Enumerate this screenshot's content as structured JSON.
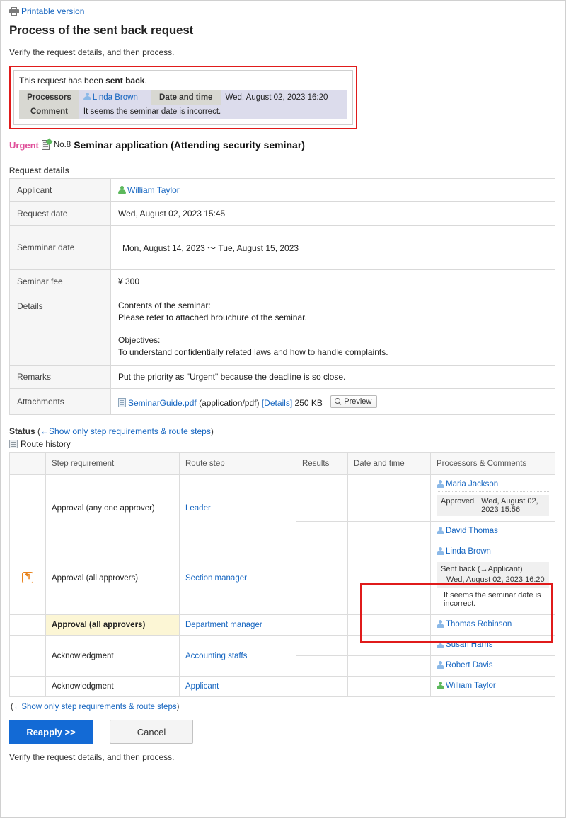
{
  "top": {
    "printable_version": "Printable version",
    "printer_icon": "printer-icon"
  },
  "page_title": "Process of the sent back request",
  "lead_text": "Verify the request details, and then process.",
  "alert": {
    "message_prefix": "This request has been ",
    "message_bold": "sent back",
    "message_suffix": ".",
    "processors_label": "Processors",
    "processor_name": "Linda Brown",
    "datetime_label": "Date and time",
    "datetime_value": "Wed, August 02, 2023 16:20",
    "comment_label": "Comment",
    "comment_value": "It seems the seminar date is incorrect."
  },
  "request_header": {
    "priority": "Urgent",
    "number": "No.8",
    "title": "Seminar application (Attending security seminar)"
  },
  "request_details": {
    "section_label": "Request details",
    "rows": [
      {
        "key": "Applicant",
        "value": "William Taylor",
        "type": "person-green"
      },
      {
        "key": "Request date",
        "value": "Wed, August 02, 2023 15:45",
        "type": "text"
      },
      {
        "key": "Semminar date",
        "value": "Mon, August 14, 2023 〜 Tue, August 15, 2023",
        "type": "indent"
      },
      {
        "key": "Seminar fee",
        "value": "¥ 300",
        "type": "text"
      },
      {
        "key": "Details",
        "value": "",
        "type": "details"
      },
      {
        "key": "Remarks",
        "value": "Put the priority as \"Urgent\" because the deadline is so close.",
        "type": "text"
      },
      {
        "key": "Attachments",
        "value": "",
        "type": "attachment"
      }
    ],
    "details_lines": [
      "Contents of the seminar:",
      "Please refer to attached brouchure of the seminar.",
      "",
      "Objectives:",
      "To understand confidentially related laws and how to handle complaints."
    ],
    "attachment": {
      "filename": "SeminarGuide.pdf",
      "mime": "(application/pdf)",
      "details_link": "[Details]",
      "size": "250 KB",
      "preview_button": "Preview"
    }
  },
  "status": {
    "label": "Status",
    "toggle_link": "(←Show only step requirements & route steps)",
    "toggle_link_text": "←Show only step requirements & route steps",
    "route_history_label": "Route history",
    "toggle_link_bottom_text": "←Show only step requirements & route steps",
    "columns": [
      "",
      "Step requirement",
      "Route step",
      "Results",
      "Date and time",
      "Processors & Comments"
    ],
    "rows": [
      {
        "icon": "",
        "step_requirement": "Approval (any one approver)",
        "route_step": "Leader",
        "results": "",
        "datetime": "",
        "current": false,
        "highlight": false,
        "processors": [
          {
            "name": "Maria Jackson",
            "result_label": "Approved",
            "result_datetime": "Wed, August 02, 2023 15:56",
            "comment": ""
          },
          {
            "name": "David Thomas",
            "result_label": "",
            "result_datetime": "",
            "comment": ""
          }
        ]
      },
      {
        "icon": "sent-back-icon",
        "step_requirement": "Approval (all approvers)",
        "route_step": "Section manager",
        "results": "",
        "datetime": "",
        "current": false,
        "highlight": true,
        "processors": [
          {
            "name": "Linda Brown",
            "result_label": "Sent back (→Applicant)",
            "result_datetime": "Wed, August 02, 2023 16:20",
            "comment": "It seems the seminar date is incorrect."
          }
        ]
      },
      {
        "icon": "",
        "step_requirement": "Approval (all approvers)",
        "route_step": "Department manager",
        "results": "",
        "datetime": "",
        "current": true,
        "highlight": false,
        "processors": [
          {
            "name": "Thomas Robinson",
            "result_label": "",
            "result_datetime": "",
            "comment": ""
          }
        ]
      },
      {
        "icon": "",
        "step_requirement": "Acknowledgment",
        "route_step": "Accounting staffs",
        "results": "",
        "datetime": "",
        "current": false,
        "highlight": false,
        "processors": [
          {
            "name": "Susan Harris",
            "result_label": "",
            "result_datetime": "",
            "comment": ""
          },
          {
            "name": "Robert Davis",
            "result_label": "",
            "result_datetime": "",
            "comment": ""
          }
        ]
      },
      {
        "icon": "",
        "step_requirement": "Acknowledgment",
        "route_step": "Applicant",
        "results": "",
        "datetime": "",
        "current": false,
        "highlight": false,
        "processors": [
          {
            "name": "William Taylor",
            "result_label": "",
            "result_datetime": "",
            "comment": "",
            "green": true
          }
        ]
      }
    ]
  },
  "footer": {
    "reapply_button": "Reapply >>",
    "cancel_button": "Cancel",
    "note": "Verify the request details, and then process."
  }
}
